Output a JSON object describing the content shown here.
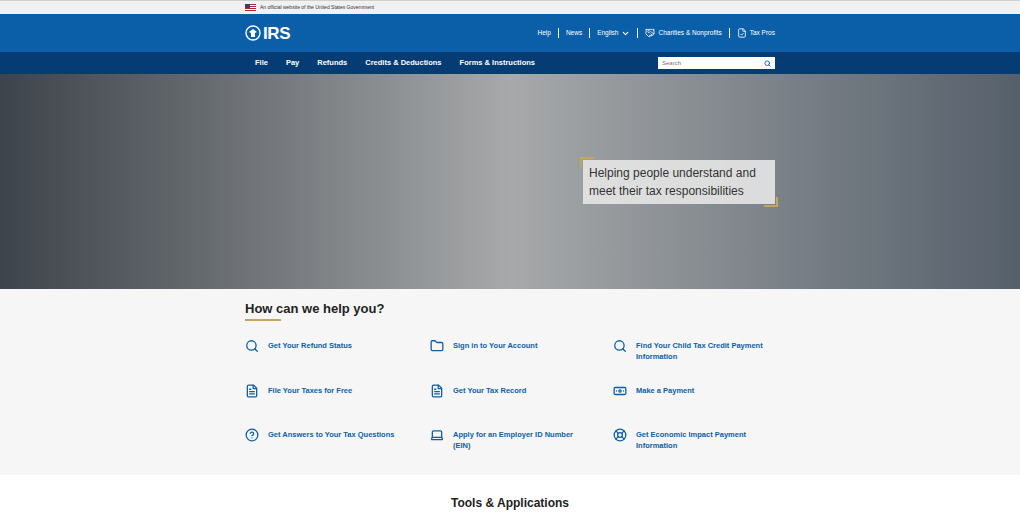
{
  "top_banner": {
    "text": "An official website of the United States Government"
  },
  "header": {
    "logo": "IRS",
    "utility_links": [
      {
        "label": "Help",
        "kind": "link"
      },
      {
        "label": "News",
        "kind": "link"
      },
      {
        "label": "English",
        "kind": "dropdown"
      },
      {
        "label": "Charities & Nonprofits",
        "kind": "icon-link"
      },
      {
        "label": "Tax Pros",
        "kind": "icon-link"
      }
    ]
  },
  "nav": {
    "items": [
      "File",
      "Pay",
      "Refunds",
      "Credits & Deductions",
      "Forms & Instructions"
    ],
    "search": {
      "placeholder": "Search"
    }
  },
  "hero": {
    "tagline": "Helping people understand and meet their tax responsibilities"
  },
  "help": {
    "heading": "How can we help you?",
    "items": [
      "Get Your Refund Status",
      "Sign in to Your Account",
      "Find Your Child Tax Credit Payment Information",
      "File Your Taxes for Free",
      "Get Your Tax Record",
      "Make a Payment",
      "Get Answers to Your Tax Questions",
      "Apply for an Employer ID Number (EIN)",
      "Get Economic Impact Payment Information"
    ]
  },
  "tools": {
    "heading": "Tools & Applications"
  }
}
